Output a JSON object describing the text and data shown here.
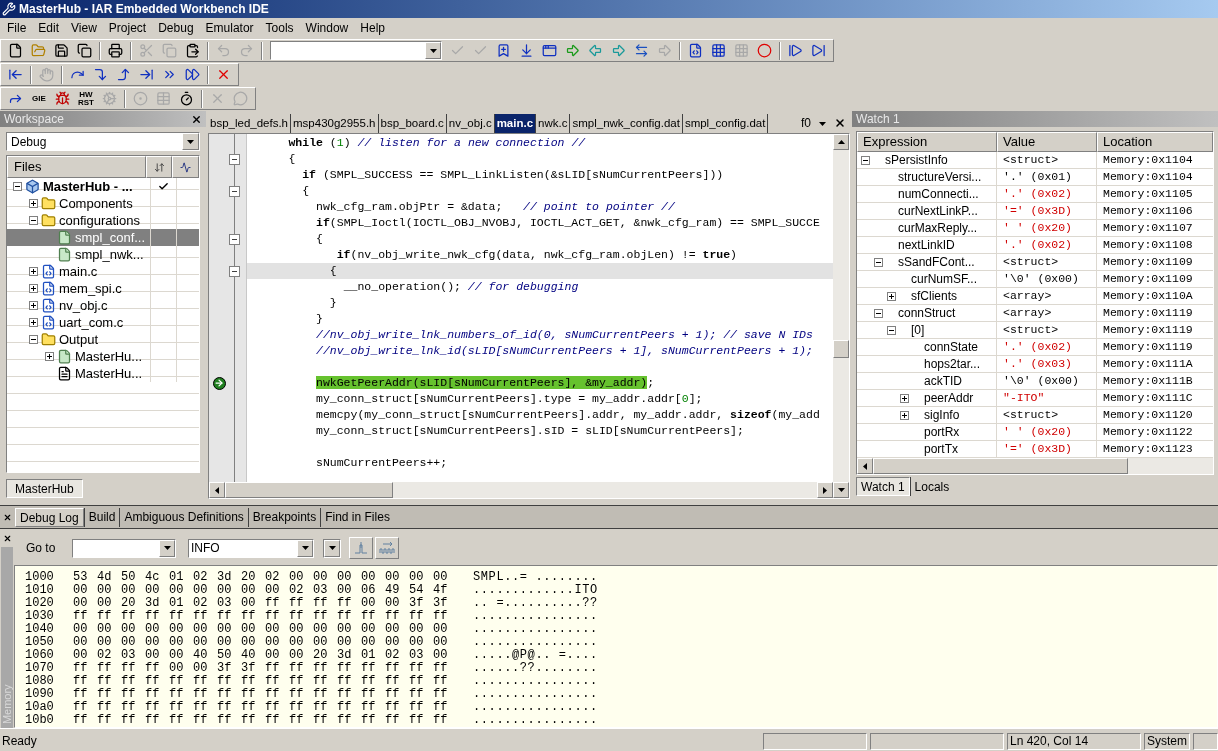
{
  "window": {
    "title": "MasterHub - IAR Embedded Workbench IDE"
  },
  "menu": [
    "File",
    "Edit",
    "View",
    "Project",
    "Debug",
    "Emulator",
    "Tools",
    "Window",
    "Help"
  ],
  "toolbars": [
    [
      {
        "kind": "icon",
        "disabled": false
      },
      {
        "kind": "icon",
        "disabled": false
      },
      {
        "kind": "icon",
        "disabled": false
      },
      {
        "kind": "icon",
        "disabled": false
      },
      {
        "kind": "sep"
      },
      {
        "kind": "icon",
        "disabled": false
      },
      {
        "kind": "sep"
      },
      {
        "kind": "icon",
        "disabled": true
      },
      {
        "kind": "icon",
        "disabled": true
      },
      {
        "kind": "icon",
        "disabled": false
      },
      {
        "kind": "sep"
      },
      {
        "kind": "icon",
        "disabled": true
      },
      {
        "kind": "icon",
        "disabled": true
      },
      {
        "kind": "sep"
      },
      {
        "kind": "combo"
      },
      {
        "kind": "icon",
        "disabled": true
      },
      {
        "kind": "icon",
        "disabled": true
      },
      {
        "kind": "icon",
        "disabled": false
      },
      {
        "kind": "icon",
        "disabled": false
      },
      {
        "kind": "icon",
        "disabled": false
      },
      {
        "kind": "icon",
        "disabled": false
      },
      {
        "kind": "icon",
        "disabled": false
      },
      {
        "kind": "icon",
        "disabled": false
      },
      {
        "kind": "icon",
        "disabled": false
      },
      {
        "kind": "icon",
        "disabled": true
      },
      {
        "kind": "sep"
      },
      {
        "kind": "icon",
        "disabled": false
      },
      {
        "kind": "icon",
        "disabled": false
      },
      {
        "kind": "icon",
        "disabled": true
      },
      {
        "kind": "icon",
        "disabled": false
      },
      {
        "kind": "sep"
      },
      {
        "kind": "icon",
        "disabled": false
      },
      {
        "kind": "icon",
        "disabled": false
      }
    ],
    [
      {
        "kind": "icon",
        "disabled": false
      },
      {
        "kind": "sep"
      },
      {
        "kind": "icon",
        "disabled": true
      },
      {
        "kind": "sep"
      },
      {
        "kind": "icon",
        "disabled": false
      },
      {
        "kind": "icon",
        "disabled": false
      },
      {
        "kind": "icon",
        "disabled": false
      },
      {
        "kind": "icon",
        "disabled": false
      },
      {
        "kind": "icon",
        "disabled": false
      },
      {
        "kind": "icon",
        "disabled": false
      },
      {
        "kind": "sep"
      },
      {
        "kind": "icon",
        "disabled": false
      }
    ],
    [
      {
        "kind": "icon",
        "disabled": false
      },
      {
        "kind": "text",
        "label": "GIE",
        "disabled": false
      },
      {
        "kind": "icon",
        "disabled": false
      },
      {
        "kind": "text",
        "label": "HW RST",
        "disabled": false
      },
      {
        "kind": "icon",
        "disabled": true
      },
      {
        "kind": "sep"
      },
      {
        "kind": "icon",
        "disabled": true
      },
      {
        "kind": "icon",
        "disabled": true
      },
      {
        "kind": "icon",
        "disabled": false
      },
      {
        "kind": "sep"
      },
      {
        "kind": "icon",
        "disabled": true
      },
      {
        "kind": "icon",
        "disabled": true
      }
    ]
  ],
  "workspace": {
    "title": "Workspace",
    "configuration": "Debug",
    "files_header": "Files",
    "tab": {
      "label": "MasterHub",
      "selected": true
    },
    "tree": [
      {
        "kind": "project",
        "label": "MasterHub - ...",
        "expanded": true,
        "selected": false,
        "checked": true,
        "children": [
          {
            "kind": "folder",
            "label": "Components",
            "expanded": false,
            "selected": false,
            "checked": false
          },
          {
            "kind": "folder",
            "label": "configurations",
            "expanded": true,
            "selected": false,
            "checked": false,
            "children": [
              {
                "kind": "file",
                "label": "smpl_conf...",
                "selected": true,
                "checked": false
              },
              {
                "kind": "file",
                "label": "smpl_nwk...",
                "selected": false,
                "checked": false
              }
            ]
          },
          {
            "kind": "cfile",
            "label": "main.c",
            "expanded": false,
            "selected": false,
            "checked": false
          },
          {
            "kind": "cfile",
            "label": "mem_spi.c",
            "expanded": false,
            "selected": false,
            "checked": false
          },
          {
            "kind": "cfile",
            "label": "nv_obj.c",
            "expanded": false,
            "selected": false,
            "checked": false
          },
          {
            "kind": "cfile",
            "label": "uart_com.c",
            "expanded": false,
            "selected": false,
            "checked": false
          },
          {
            "kind": "folder",
            "label": "Output",
            "expanded": true,
            "selected": false,
            "checked": false,
            "children": [
              {
                "kind": "file",
                "label": "MasterHu...",
                "expanded": false,
                "selected": false,
                "checked": false
              },
              {
                "kind": "doc",
                "label": "MasterHu...",
                "selected": false,
                "checked": false
              }
            ]
          }
        ]
      }
    ]
  },
  "editor": {
    "tabs": [
      {
        "label": "bsp_led_defs.h",
        "selected": false
      },
      {
        "label": "msp430g2955.h",
        "selected": false
      },
      {
        "label": "bsp_board.c",
        "selected": false
      },
      {
        "label": "nv_obj.c",
        "selected": false
      },
      {
        "label": "main.c",
        "selected": true
      },
      {
        "label": "nwk.c",
        "selected": false
      },
      {
        "label": "smpl_nwk_config.dat",
        "selected": false
      },
      {
        "label": "smpl_config.dat",
        "selected": false
      }
    ],
    "function_label": "f0",
    "lines": [
      {
        "fold": false,
        "caret": false,
        "current": false,
        "tokens": [
          {
            "kind": "kw",
            "t": "      while"
          },
          {
            "kind": "tx",
            "t": " ("
          },
          {
            "kind": "num",
            "t": "1"
          },
          {
            "kind": "tx",
            "t": ") "
          },
          {
            "kind": "cm",
            "t": "// listen for a new connection //"
          }
        ]
      },
      {
        "fold": true,
        "caret": false,
        "current": false,
        "tokens": [
          {
            "kind": "tx",
            "t": "      {"
          }
        ]
      },
      {
        "fold": false,
        "caret": false,
        "current": false,
        "tokens": [
          {
            "kind": "kw",
            "t": "        if"
          },
          {
            "kind": "tx",
            "t": " (SMPL_SUCCESS == SMPL_LinkListen(&sLID[sNumCurrentPeers]))"
          }
        ]
      },
      {
        "fold": true,
        "caret": false,
        "current": false,
        "tokens": [
          {
            "kind": "tx",
            "t": "        {"
          }
        ]
      },
      {
        "fold": false,
        "caret": false,
        "current": false,
        "tokens": [
          {
            "kind": "tx",
            "t": "          nwk_cfg_ram.objPtr = &data;   "
          },
          {
            "kind": "cm",
            "t": "// point to pointer //"
          }
        ]
      },
      {
        "fold": false,
        "caret": false,
        "current": false,
        "tokens": [
          {
            "kind": "kw",
            "t": "          if"
          },
          {
            "kind": "tx",
            "t": "(SMPL_Ioctl(IOCTL_OBJ_NVOBJ, IOCTL_ACT_GET, &nwk_cfg_ram) == SMPL_SUCCE"
          }
        ]
      },
      {
        "fold": true,
        "caret": false,
        "current": false,
        "tokens": [
          {
            "kind": "tx",
            "t": "          {"
          }
        ]
      },
      {
        "fold": false,
        "caret": false,
        "current": false,
        "tokens": [
          {
            "kind": "kw",
            "t": "             if"
          },
          {
            "kind": "tx",
            "t": "(nv_obj_write_nwk_cfg(data, nwk_cfg_ram.objLen) != "
          },
          {
            "kind": "kw",
            "t": "true"
          },
          {
            "kind": "tx",
            "t": ")"
          }
        ]
      },
      {
        "fold": true,
        "caret": true,
        "current": false,
        "tokens": [
          {
            "kind": "tx",
            "t": "            {"
          }
        ]
      },
      {
        "fold": false,
        "caret": false,
        "current": false,
        "tokens": [
          {
            "kind": "tx",
            "t": "              __no_operation(); "
          },
          {
            "kind": "cm",
            "t": "// for debugging"
          }
        ]
      },
      {
        "fold": false,
        "caret": false,
        "current": false,
        "tokens": [
          {
            "kind": "tx",
            "t": "            }"
          }
        ]
      },
      {
        "fold": false,
        "caret": false,
        "current": false,
        "tokens": [
          {
            "kind": "tx",
            "t": "          }"
          }
        ]
      },
      {
        "fold": false,
        "caret": false,
        "current": false,
        "tokens": [
          {
            "kind": "cm",
            "t": "          //nv_obj_write_lnk_numbers_of_id(0, sNumCurrentPeers + 1); // save N IDs"
          }
        ]
      },
      {
        "fold": false,
        "caret": false,
        "current": false,
        "tokens": [
          {
            "kind": "cm",
            "t": "          //nv_obj_write_lnk_id(sLID[sNumCurrentPeers + 1], sNumCurrentPeers + 1);"
          }
        ]
      },
      {
        "fold": false,
        "caret": false,
        "current": false
      },
      {
        "fold": false,
        "caret": false,
        "current": true,
        "tokens": [
          {
            "kind": "stmt",
            "t": "          nwkGetPeerAddr(sLID[sNumCurrentPeers], &my_addr)"
          },
          {
            "kind": "tx",
            "t": ";"
          }
        ]
      },
      {
        "fold": false,
        "caret": false,
        "current": false,
        "tokens": [
          {
            "kind": "tx",
            "t": "          my_conn_struct[sNumCurrentPeers].type = my_addr.addr["
          },
          {
            "kind": "num",
            "t": "0"
          },
          {
            "kind": "tx",
            "t": "];"
          }
        ]
      },
      {
        "fold": false,
        "caret": false,
        "current": false,
        "tokens": [
          {
            "kind": "tx",
            "t": "          memcpy(my_conn_struct[sNumCurrentPeers].addr, my_addr.addr, "
          },
          {
            "kind": "kw",
            "t": "sizeof"
          },
          {
            "kind": "tx",
            "t": "(my_add"
          }
        ]
      },
      {
        "fold": false,
        "caret": false,
        "current": false,
        "tokens": [
          {
            "kind": "tx",
            "t": "          my_conn_struct[sNumCurrentPeers].sID = sLID[sNumCurrentPeers];"
          }
        ]
      },
      {
        "fold": false,
        "caret": false,
        "current": false
      },
      {
        "fold": false,
        "caret": false,
        "current": false,
        "tokens": [
          {
            "kind": "tx",
            "t": "          sNumCurrentPeers++;"
          }
        ]
      }
    ]
  },
  "watch": {
    "title": "Watch 1",
    "columns": [
      "Expression",
      "Value",
      "Location"
    ],
    "rows": [
      {
        "kind": "group",
        "expression": "sPersistInfo",
        "value": "<struct>",
        "location": "Memory:0x1104",
        "changed": false,
        "expanded": true,
        "children": [
          {
            "kind": "leaf",
            "expression": "structureVersi...",
            "value": "'.' (0x01)",
            "location": "Memory:0x1104",
            "changed": false
          },
          {
            "kind": "leaf",
            "expression": "numConnecti...",
            "value": "'.' (0x02)",
            "location": "Memory:0x1105",
            "changed": true
          },
          {
            "kind": "leaf",
            "expression": "curNextLinkP...",
            "value": "'=' (0x3D)",
            "location": "Memory:0x1106",
            "changed": true
          },
          {
            "kind": "leaf",
            "expression": "curMaxReply...",
            "value": "' ' (0x20)",
            "location": "Memory:0x1107",
            "changed": true
          },
          {
            "kind": "leaf",
            "expression": "nextLinkID",
            "value": "'.' (0x02)",
            "location": "Memory:0x1108",
            "changed": true
          },
          {
            "kind": "group",
            "expression": "sSandFCont...",
            "value": "<struct>",
            "location": "Memory:0x1109",
            "changed": false,
            "expanded": true,
            "children": [
              {
                "kind": "leaf",
                "expression": "curNumSF...",
                "value": "'\\0' (0x00)",
                "location": "Memory:0x1109",
                "changed": false
              },
              {
                "kind": "group",
                "expression": "sfClients",
                "value": "<array>",
                "location": "Memory:0x110A",
                "changed": false,
                "expanded": false
              }
            ]
          },
          {
            "kind": "group",
            "expression": "connStruct",
            "value": "<array>",
            "location": "Memory:0x1119",
            "changed": false,
            "expanded": true,
            "children": [
              {
                "kind": "group",
                "expression": "[0]",
                "value": "<struct>",
                "location": "Memory:0x1119",
                "changed": false,
                "expanded": true,
                "children": [
                  {
                    "kind": "leaf",
                    "expression": "connState",
                    "value": "'.' (0x02)",
                    "location": "Memory:0x1119",
                    "changed": true
                  },
                  {
                    "kind": "leaf",
                    "expression": "hops2tar...",
                    "value": "'.' (0x03)",
                    "location": "Memory:0x111A",
                    "changed": true
                  },
                  {
                    "kind": "leaf",
                    "expression": "ackTID",
                    "value": "'\\0' (0x00)",
                    "location": "Memory:0x111B",
                    "changed": false
                  },
                  {
                    "kind": "group",
                    "expression": "peerAddr",
                    "value": "\"-ITO\"",
                    "location": "Memory:0x111C",
                    "changed": true,
                    "expanded": false
                  },
                  {
                    "kind": "group",
                    "expression": "sigInfo",
                    "value": "<struct>",
                    "location": "Memory:0x1120",
                    "changed": false,
                    "expanded": false
                  },
                  {
                    "kind": "leaf",
                    "expression": "portRx",
                    "value": "' ' (0x20)",
                    "location": "Memory:0x1122",
                    "changed": true
                  },
                  {
                    "kind": "leaf",
                    "expression": "portTx",
                    "value": "'=' (0x3D)",
                    "location": "Memory:0x1123",
                    "changed": true
                  }
                ]
              }
            ]
          }
        ]
      }
    ],
    "tabs": [
      {
        "label": "Watch 1",
        "selected": true
      },
      {
        "label": "Locals",
        "selected": false
      }
    ]
  },
  "output_tabs": [
    {
      "label": "Debug Log",
      "selected": true
    },
    {
      "label": "Build",
      "selected": false
    },
    {
      "label": "Ambiguous Definitions",
      "selected": false
    },
    {
      "label": "Breakpoints",
      "selected": false
    },
    {
      "label": "Find in Files",
      "selected": false
    }
  ],
  "memory": {
    "title": "Memory",
    "goto_label": "Go to",
    "zone": "INFO",
    "rows": [
      {
        "address": "1000",
        "bytes": "53 4d 50 4c 01 02 3d 20 02 00 00 00 00 00 00 00",
        "ascii": "SMPL..= ........"
      },
      {
        "address": "1010",
        "bytes": "00 00 00 00 00 00 00 00 00 02 03 00 06 49 54 4f",
        "ascii": ".............ITO"
      },
      {
        "address": "1020",
        "bytes": "00 00 20 3d 01 02 03 00 ff ff ff ff 00 00 3f 3f",
        "ascii": ".. =..........??"
      },
      {
        "address": "1030",
        "bytes": "ff ff ff ff ff ff ff ff ff ff ff ff ff ff ff ff",
        "ascii": "................"
      },
      {
        "address": "1040",
        "bytes": "00 00 00 00 00 00 00 00 00 00 00 00 00 00 00 00",
        "ascii": "................"
      },
      {
        "address": "1050",
        "bytes": "00 00 00 00 00 00 00 00 00 00 00 00 00 00 00 00",
        "ascii": "................"
      },
      {
        "address": "1060",
        "bytes": "00 02 03 00 00 40 50 40 00 00 20 3d 01 02 03 00",
        "ascii": ".....@P@.. =...."
      },
      {
        "address": "1070",
        "bytes": "ff ff ff ff 00 00 3f 3f ff ff ff ff ff ff ff ff",
        "ascii": "......??........"
      },
      {
        "address": "1080",
        "bytes": "ff ff ff ff ff ff ff ff ff ff ff ff ff ff ff ff",
        "ascii": "................"
      },
      {
        "address": "1090",
        "bytes": "ff ff ff ff ff ff ff ff ff ff ff ff ff ff ff ff",
        "ascii": "................"
      },
      {
        "address": "10a0",
        "bytes": "ff ff ff ff ff ff ff ff ff ff ff ff ff ff ff ff",
        "ascii": "................"
      },
      {
        "address": "10b0",
        "bytes": "ff ff ff ff ff ff ff ff ff ff ff ff ff ff ff ff",
        "ascii": "................"
      }
    ]
  },
  "status_bar": {
    "message": "Ready",
    "position": "Ln 420, Col 14",
    "mode": "System"
  }
}
